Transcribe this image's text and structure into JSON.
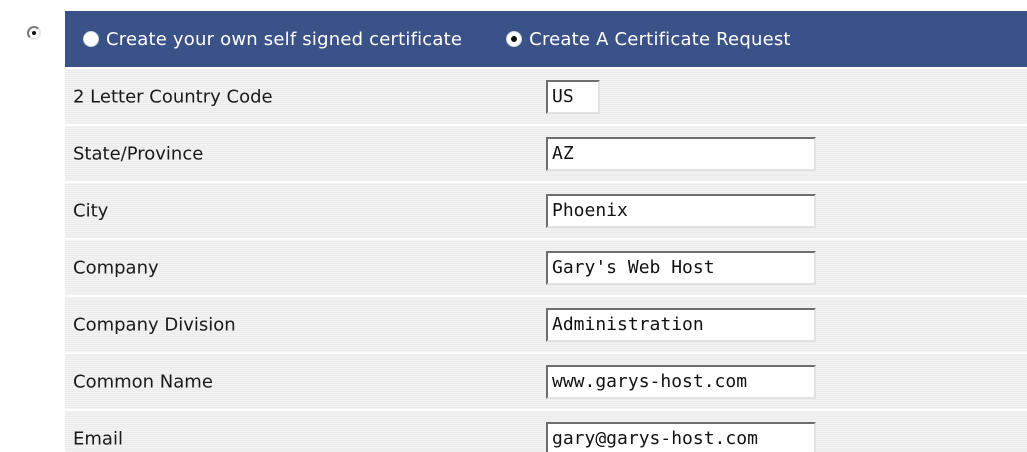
{
  "mode": {
    "options": [
      {
        "label": "Create your own self signed certificate",
        "selected": false
      },
      {
        "label": "Create A Certificate Request",
        "selected": true
      }
    ]
  },
  "fields": [
    {
      "label": "2 Letter Country Code",
      "value": "US"
    },
    {
      "label": "State/Province",
      "value": "AZ"
    },
    {
      "label": "City",
      "value": "Phoenix"
    },
    {
      "label": "Company",
      "value": "Gary's Web Host"
    },
    {
      "label": "Company Division",
      "value": "Administration"
    },
    {
      "label": "Common Name",
      "value": "www.garys-host.com"
    },
    {
      "label": "Email",
      "value": "gary@garys-host.com"
    }
  ],
  "colors": {
    "header_background": "#3b5288",
    "row_background": "#ececec"
  }
}
